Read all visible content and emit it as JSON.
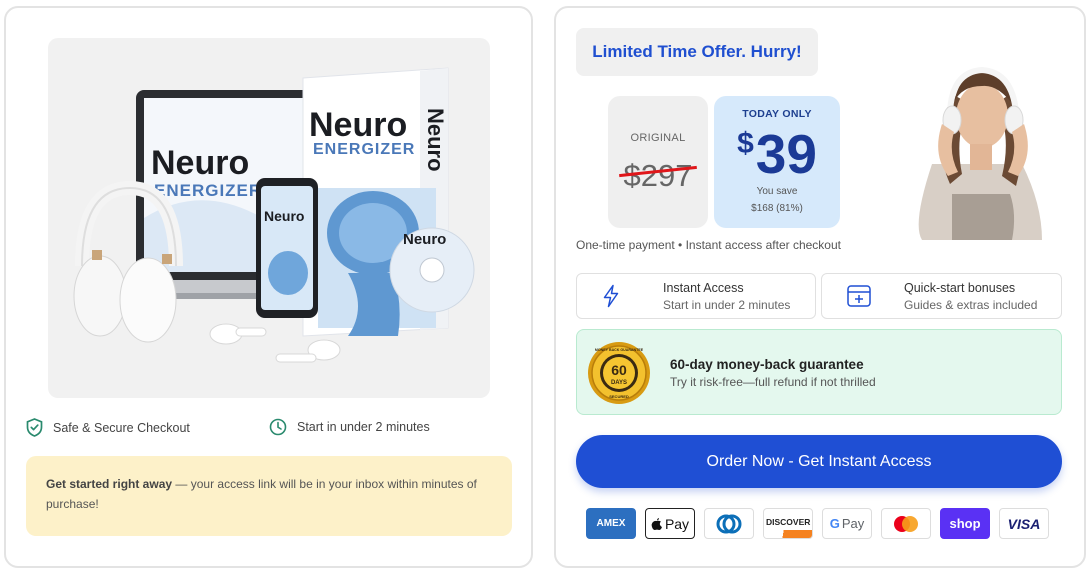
{
  "left": {
    "product_image": {
      "alt_brand": "Neuro",
      "alt_sub": "ENERGIZER"
    },
    "trust": [
      {
        "icon": "shield-check-icon",
        "label": "Safe & Secure Checkout"
      },
      {
        "icon": "clock-icon",
        "label": "Start in under 2 minutes"
      }
    ],
    "note": {
      "bold": "Get started right away",
      "rest": " — your access link will be in your inbox within minutes of purchase!"
    }
  },
  "right": {
    "offer_badge": "Limited Time Offer. Hurry!",
    "price": {
      "original_label": "ORIGINAL",
      "original_value": "$297",
      "today_label": "TODAY ONLY",
      "currency": "$",
      "today_value": "39",
      "you_save": "You save",
      "save_amount": "$168 (81%)"
    },
    "onetime": "One-time payment • Instant access after checkout",
    "features": [
      {
        "icon": "lightning-icon",
        "title": "Instant Access",
        "sub": "Start in under 2 minutes"
      },
      {
        "icon": "gift-box-icon",
        "title": "Quick-start bonuses",
        "sub": "Guides & extras included"
      }
    ],
    "guarantee": {
      "seal_top": "MONEY BACK GUARANTEE",
      "seal_num": "60",
      "seal_days": "DAYS",
      "seal_bottom": "SECURED",
      "title": "60-day money-back guarantee",
      "sub": "Try it risk-free—full refund if not thrilled"
    },
    "cta": "Order Now - Get Instant Access",
    "payments": {
      "amex": "AMEX",
      "applepay": "Pay",
      "diners": "D",
      "discover": "DISCOVER",
      "gpay_g": "G",
      "gpay": "Pay",
      "mastercard": "",
      "shop": "shop",
      "visa": "VISA"
    }
  },
  "colors": {
    "accent_blue": "#1f4fd4",
    "today_bg": "#d6e9fb",
    "note_bg": "#fdf1c9",
    "guarantee_bg": "#e4f8ee",
    "strike_red": "#e0161a",
    "icon_teal": "#2a8a6e"
  }
}
